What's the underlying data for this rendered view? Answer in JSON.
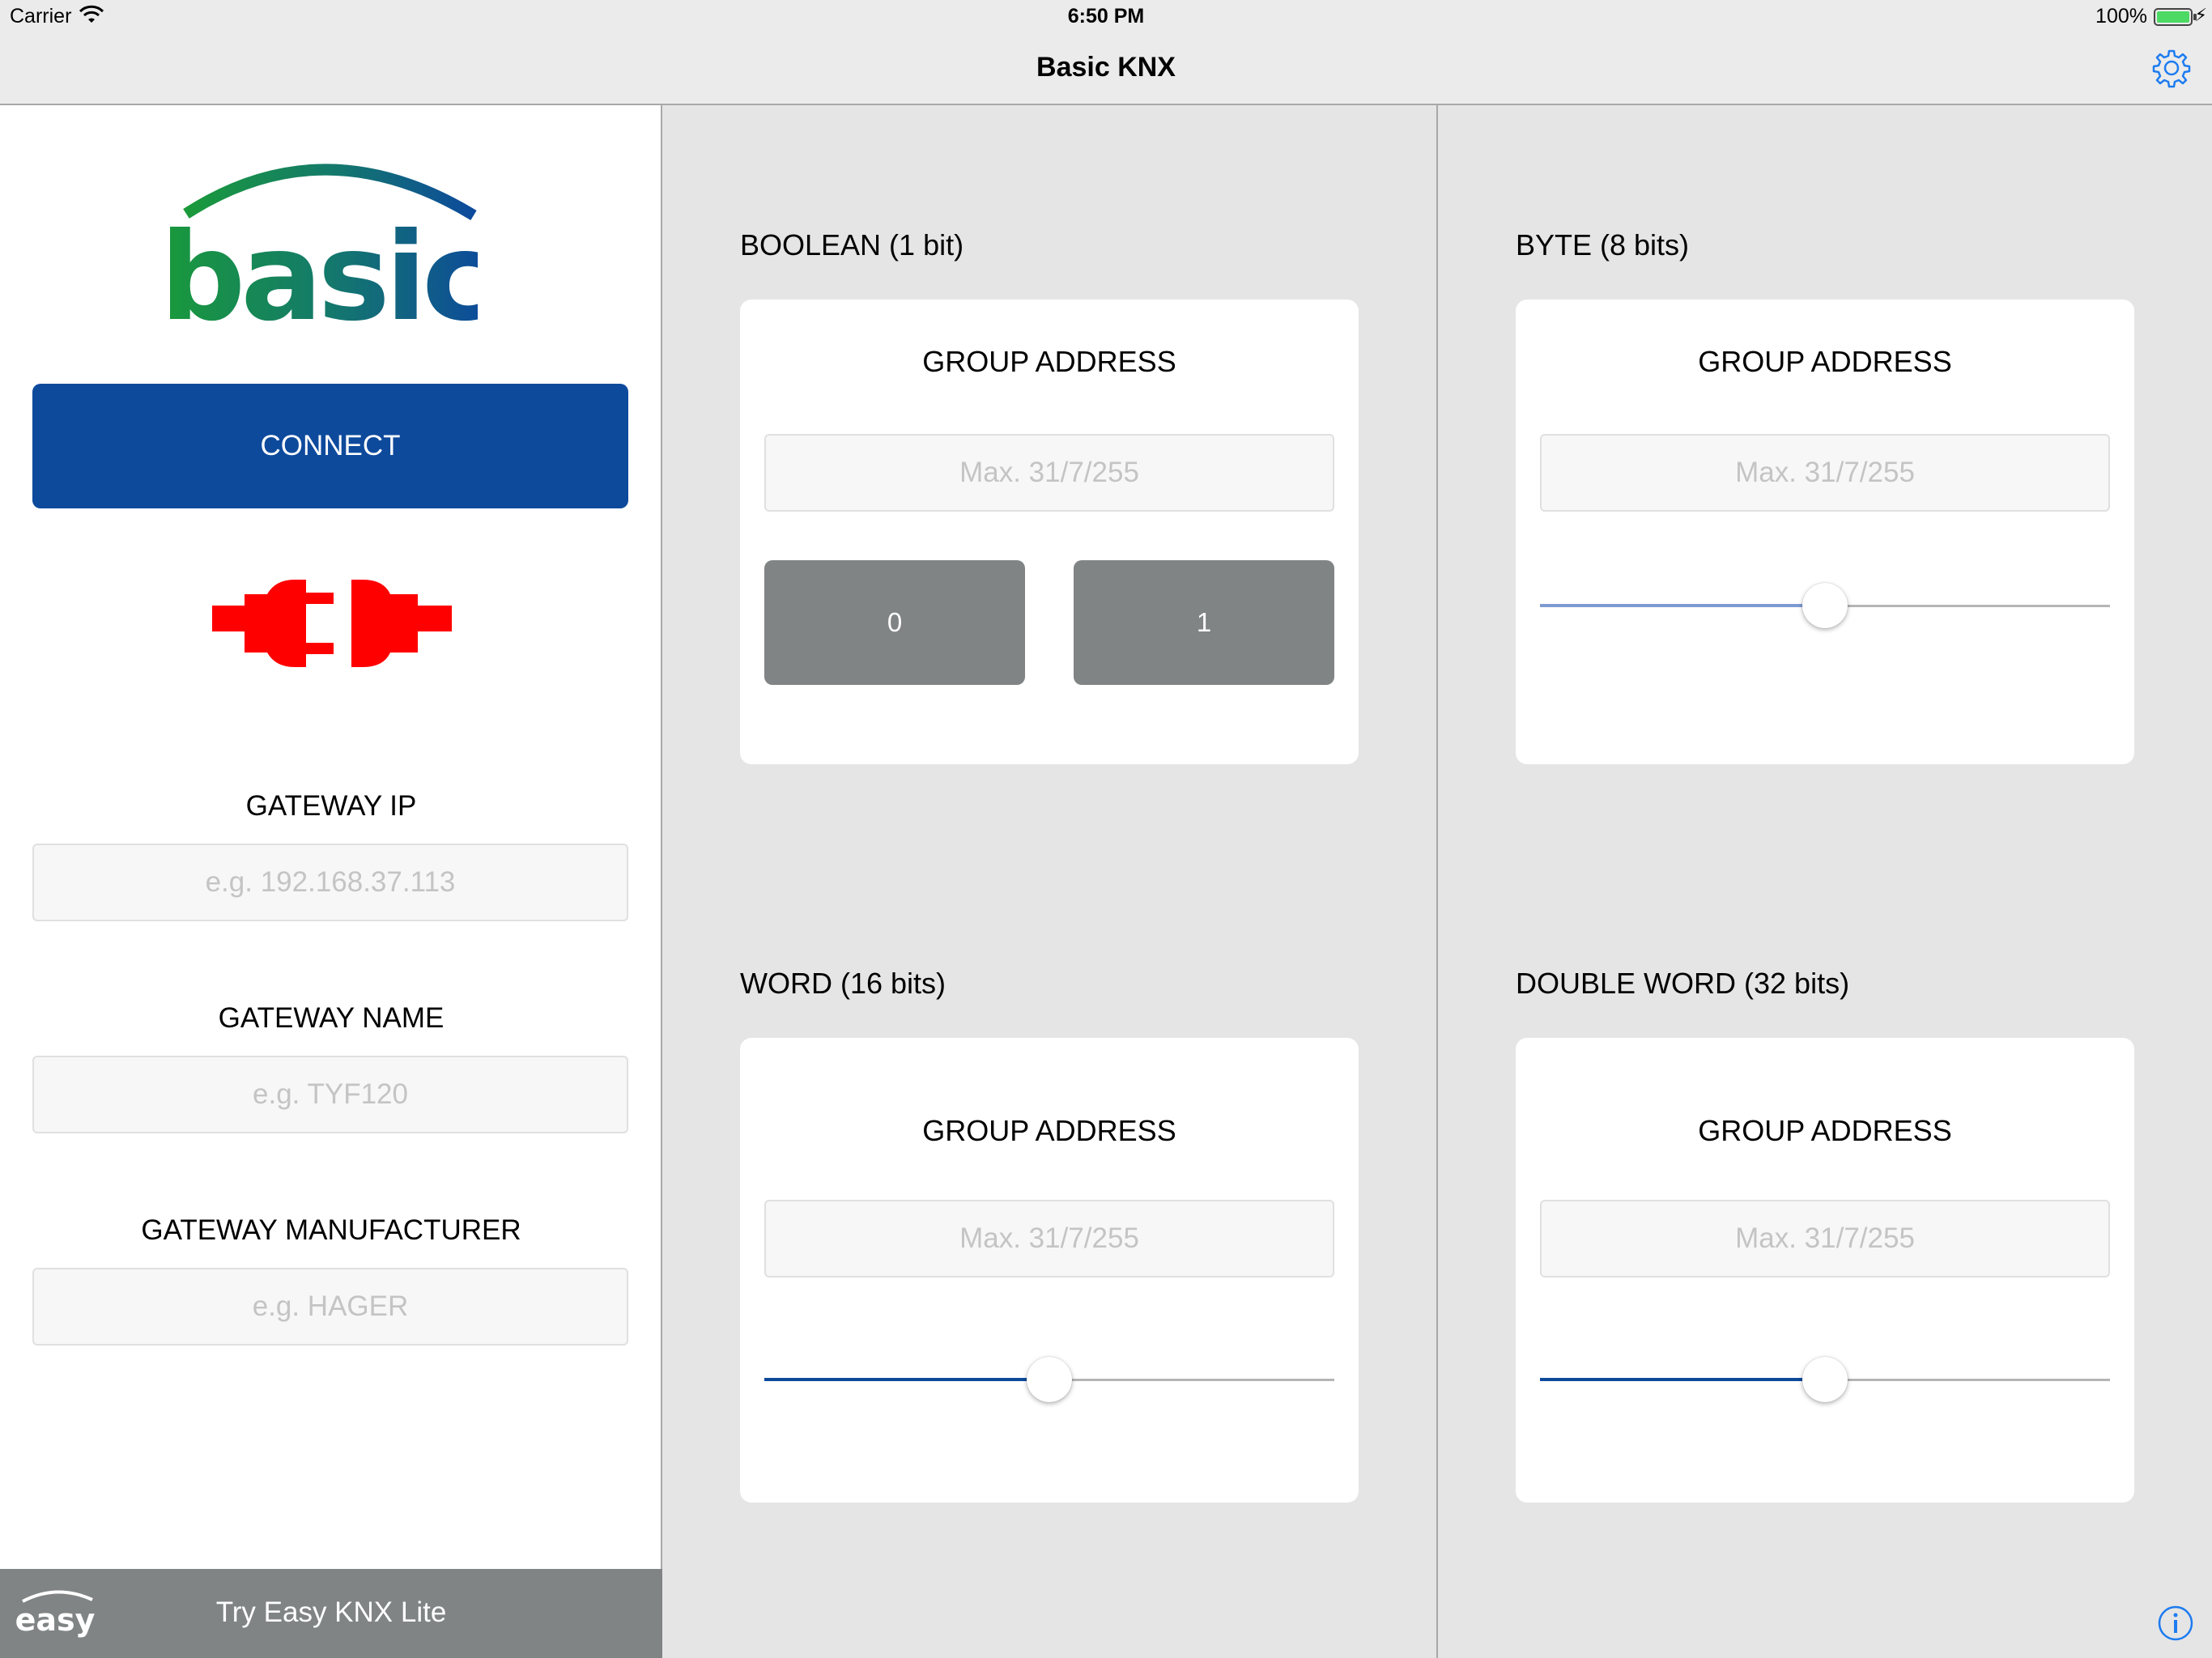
{
  "status_bar": {
    "carrier": "Carrier",
    "time": "6:50 PM",
    "battery": "100%"
  },
  "nav": {
    "title": "Basic KNX",
    "settings_icon": "gear-icon"
  },
  "sidebar": {
    "logo_text": "basic",
    "connect_label": "CONNECT",
    "connection_icon": "disconnected-plug-icon",
    "connection_color": "#ff0000",
    "gateway_ip": {
      "label": "GATEWAY IP",
      "placeholder": "e.g. 192.168.37.113",
      "value": ""
    },
    "gateway_name": {
      "label": "GATEWAY NAME",
      "placeholder": "e.g. TYF120",
      "value": ""
    },
    "gateway_manufacturer": {
      "label": "GATEWAY MANUFACTURER",
      "placeholder": "e.g. HAGER",
      "value": ""
    },
    "footer": {
      "logo_text": "easy",
      "label": "Try Easy KNX Lite"
    }
  },
  "panels": {
    "boolean": {
      "title": "BOOLEAN (1 bit)",
      "group_address_label": "GROUP ADDRESS",
      "placeholder": "Max. 31/7/255",
      "button_0": "0",
      "button_1": "1"
    },
    "byte": {
      "title": "BYTE (8 bits)",
      "group_address_label": "GROUP ADDRESS",
      "placeholder": "Max. 31/7/255",
      "slider_value": 0.5,
      "slider_color": "#7d9bd1"
    },
    "word": {
      "title": "WORD (16 bits)",
      "group_address_label": "GROUP ADDRESS",
      "placeholder": "Max. 31/7/255",
      "slider_value": 0.5,
      "slider_color": "#0d4a9c"
    },
    "double_word": {
      "title": "DOUBLE WORD (32 bits)",
      "group_address_label": "GROUP ADDRESS",
      "placeholder": "Max. 31/7/255",
      "slider_value": 0.5,
      "slider_color": "#0d4a9c"
    }
  },
  "colors": {
    "accent": "#0d4a9c",
    "button_gray": "#808484",
    "background": "#e5e5e5",
    "settings_blue": "#1e7cf0"
  }
}
